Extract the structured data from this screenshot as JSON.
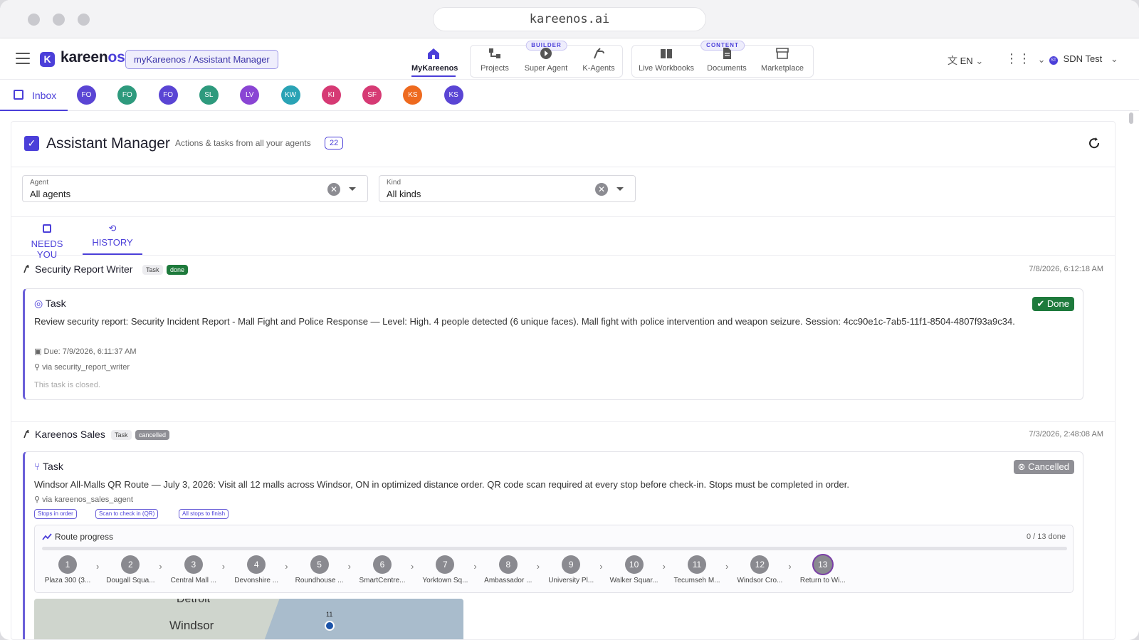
{
  "browser": {
    "url": "kareenos.ai"
  },
  "app": {
    "brand_prefix": "kareen",
    "brand_suffix": "os",
    "logo_letter": "K",
    "breadcrumb": "myKareenos / Assistant Manager",
    "nav": {
      "mykareenos": "MyKareenos",
      "builder_tag": "BUILDER",
      "projects": "Projects",
      "super_agent": "Super Agent",
      "k_agents": "K-Agents",
      "content_tag": "CONTENT",
      "live_workbooks": "Live Workbooks",
      "documents": "Documents",
      "marketplace": "Marketplace"
    },
    "language": "EN",
    "workspace": "SDN Test",
    "workspace_badge": "ST"
  },
  "tabs": {
    "inbox": "Inbox",
    "avatars": [
      {
        "initials": "FO",
        "color": "#5a45d4"
      },
      {
        "initials": "FO",
        "color": "#2e9a7d"
      },
      {
        "initials": "FO",
        "color": "#5a45d4"
      },
      {
        "initials": "SL",
        "color": "#2e9a7d"
      },
      {
        "initials": "LV",
        "color": "#8a45d4"
      },
      {
        "initials": "KW",
        "color": "#2aa3b5"
      },
      {
        "initials": "KI",
        "color": "#d63a74"
      },
      {
        "initials": "SF",
        "color": "#d63a74"
      },
      {
        "initials": "KS",
        "color": "#ee6a1f"
      },
      {
        "initials": "KS",
        "color": "#5a45d4"
      }
    ]
  },
  "panel": {
    "title": "Assistant Manager",
    "subtitle": "Actions & tasks from all your agents",
    "count": "22",
    "filters": {
      "agent_label": "Agent",
      "agent_value": "All agents",
      "kind_label": "Kind",
      "kind_value": "All kinds"
    },
    "subtabs": {
      "needs_you": "NEEDS YOU",
      "history": "HISTORY"
    }
  },
  "items": [
    {
      "agent": "Security Report Writer",
      "kind_pill": "Task",
      "status_pill": "done",
      "timestamp": "7/8/2026, 6:12:18 AM",
      "card_kind": "Task",
      "status": "Done",
      "description": "Review security report: Security Incident Report - Mall Fight and Police Response — Level: High. 4 people detected (6 unique faces). Mall fight with police intervention and weapon seizure. Session: 4cc90e1c-7ab5-11f1-8504-4807f93a9c34.",
      "due": "Due: 7/9/2026, 6:11:37 AM",
      "via": "via security_report_writer",
      "closed": "This task is closed."
    },
    {
      "agent": "Kareenos Sales",
      "kind_pill": "Task",
      "status_pill": "cancelled",
      "timestamp": "7/3/2026, 2:48:08 AM",
      "card_kind": "Task",
      "status": "Cancelled",
      "description": "Windsor All-Malls QR Route — July 3, 2026: Visit all 12 malls across Windsor, ON in optimized distance order. QR code scan required at every stop before check-in. Stops must be completed in order.",
      "via": "via kareenos_sales_agent",
      "rules": [
        "Stops in order",
        "Scan to check in (QR)",
        "All stops to finish"
      ],
      "route": {
        "title": "Route progress",
        "progress_text": "0 / 13 done",
        "done": 0,
        "total": 13,
        "stops": [
          {
            "n": "1",
            "label": "Plaza 300 (3..."
          },
          {
            "n": "2",
            "label": "Dougall Squa..."
          },
          {
            "n": "3",
            "label": "Central Mall ..."
          },
          {
            "n": "4",
            "label": "Devonshire ..."
          },
          {
            "n": "5",
            "label": "Roundhouse ..."
          },
          {
            "n": "6",
            "label": "SmartCentre..."
          },
          {
            "n": "7",
            "label": "Yorktown Sq..."
          },
          {
            "n": "8",
            "label": "Ambassador ..."
          },
          {
            "n": "9",
            "label": "University Pl..."
          },
          {
            "n": "10",
            "label": "Walker Squar..."
          },
          {
            "n": "11",
            "label": "Tecumseh M..."
          },
          {
            "n": "12",
            "label": "Windsor Cro..."
          },
          {
            "n": "13",
            "label": "Return to Wi..."
          }
        ]
      },
      "map": {
        "city_label": "Windsor",
        "top_label": "Detroit",
        "pin_label": "11"
      }
    }
  ]
}
